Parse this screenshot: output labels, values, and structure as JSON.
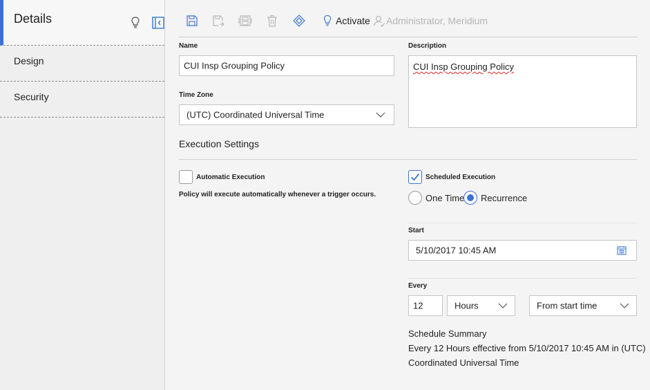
{
  "sidebar": {
    "title": "Details",
    "items": [
      {
        "label": "Design"
      },
      {
        "label": "Security"
      }
    ]
  },
  "toolbar": {
    "icons": [
      "save-icon",
      "save-as-icon",
      "save-all-icon",
      "delete-icon",
      "validate-icon"
    ],
    "activate_label": "Activate",
    "user_label": "Administrator, Meridium"
  },
  "form": {
    "name_label": "Name",
    "name_value": "CUI Insp Grouping Policy",
    "description_label": "Description",
    "description_value": "CUI Insp Grouping Policy",
    "timezone_label": "Time Zone",
    "timezone_value": "(UTC) Coordinated Universal Time"
  },
  "execution": {
    "title": "Execution Settings",
    "automatic_label": "Automatic Execution",
    "automatic_checked": false,
    "automatic_help": "Policy will execute automatically whenever a trigger occurs.",
    "scheduled_label": "Scheduled Execution",
    "scheduled_checked": true,
    "one_time_label": "One Time",
    "recurrence_label": "Recurrence",
    "selected_mode": "Recurrence",
    "start_label": "Start",
    "start_value": "5/10/2017 10:45 AM",
    "every_label": "Every",
    "every_value": "12",
    "unit_value": "Hours",
    "from_value": "From start time",
    "summary_title": "Schedule Summary",
    "summary_line1": "Every 12 Hours effective from 5/10/2017 10:45 AM in (UTC)",
    "summary_line2": "Coordinated Universal Time"
  },
  "colors": {
    "accent": "#3b73d4",
    "disabled": "#b5b5b5"
  }
}
